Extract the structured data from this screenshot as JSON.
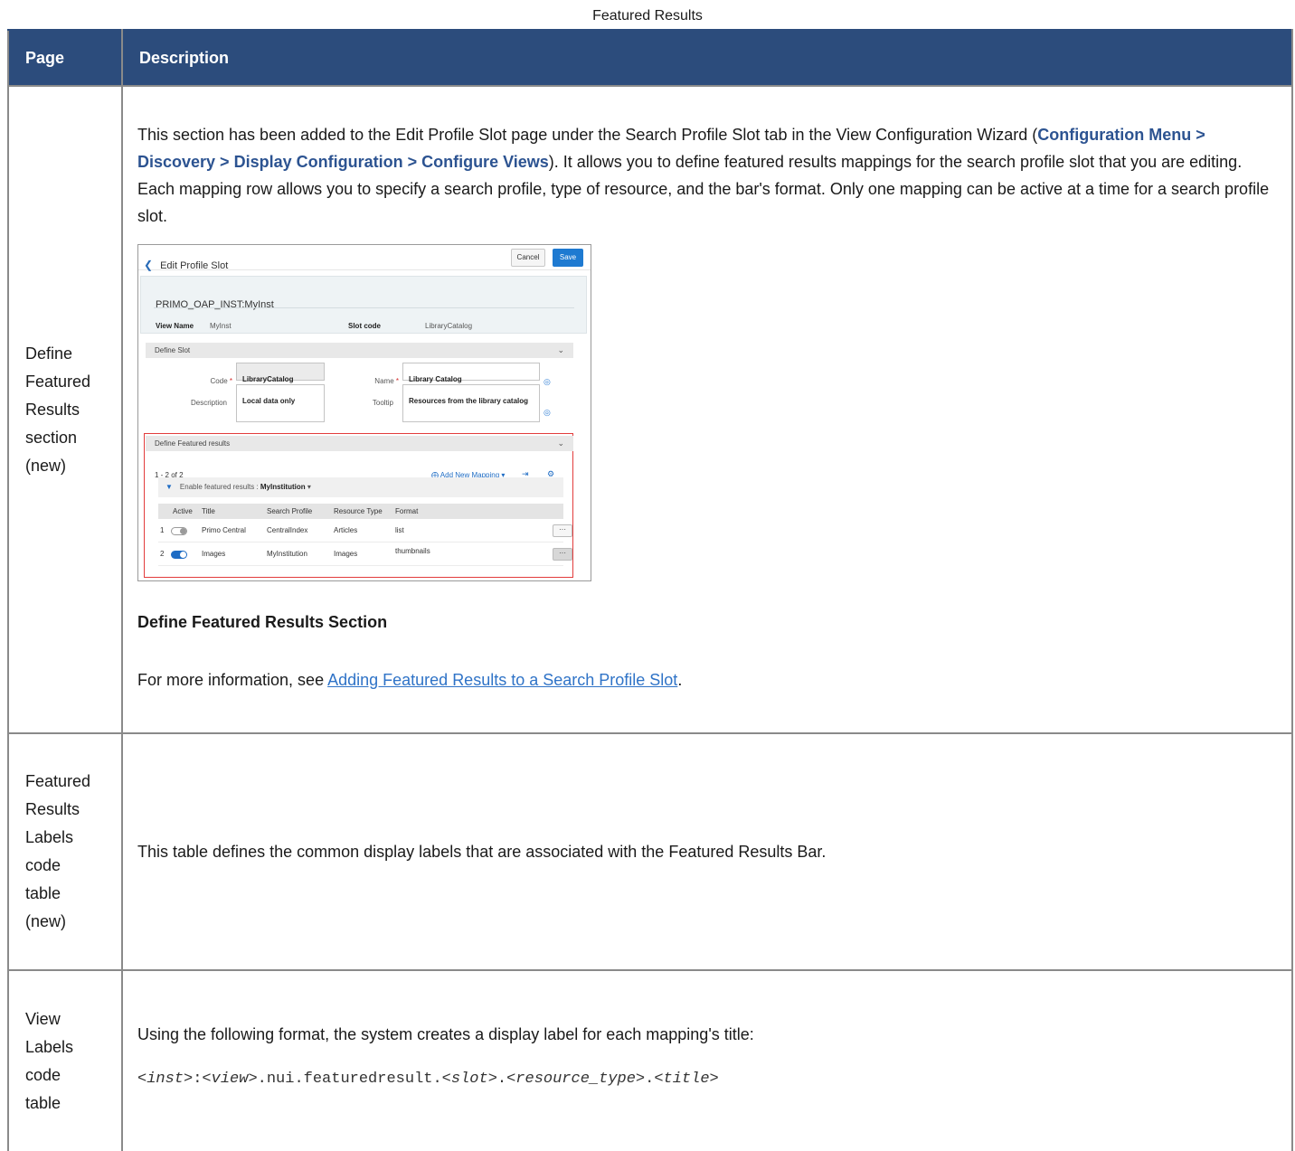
{
  "caption": "Featured Results",
  "header": {
    "col_page": "Page",
    "col_description": "Description"
  },
  "rows": [
    {
      "page": [
        "Define",
        "Featured",
        "Results",
        "section",
        "(new)"
      ],
      "intro_1": "This section has been added to the Edit Profile Slot page under the Search Profile Slot tab in the View Configuration Wizard (",
      "menu_path": "Configuration Menu > Discovery > Display Configuration > Configure Views",
      "intro_2": "). It allows you to define featured results mappings for the search profile slot that you are editing. Each mapping row allows you to specify a search profile, type of resource, and the bar's format. Only one mapping can be active at a time for a search profile slot.",
      "figure_caption": "Define Featured Results Section",
      "more_info_prefix": "For more information, see ",
      "more_info_link": "Adding Featured Results to a Search Profile Slot",
      "more_info_suffix": "."
    },
    {
      "page": [
        "Featured",
        "Results",
        "Labels",
        "code",
        "table",
        "(new)"
      ],
      "text": "This table defines the common display labels that are associated with the Featured Results Bar."
    },
    {
      "page": [
        "View",
        "Labels",
        "code",
        "table"
      ],
      "text": "Using the following format, the system creates a display label for each mapping's title:",
      "code_parts": [
        "<",
        "inst",
        ">:<",
        "view",
        ">.nui.featuredresult.<",
        "slot",
        ">.<",
        "resource_type",
        ">.<",
        "title",
        ">"
      ]
    }
  ],
  "screenshot": {
    "title": "Edit Profile Slot",
    "cancel": "Cancel",
    "save": "Save",
    "inst": "PRIMO_OAP_INST:MyInst",
    "view_name_label": "View Name",
    "view_name_value": "MyInst",
    "slot_code_label": "Slot code",
    "slot_code_value": "LibraryCatalog",
    "define_slot": "Define Slot",
    "code_label": "Code",
    "code_value": "LibraryCatalog",
    "name_label": "Name",
    "name_value": "Library Catalog",
    "description_label": "Description",
    "description_value": "Local data only",
    "tooltip_label": "Tooltip",
    "tooltip_value": "Resources from the library catalog",
    "define_featured": "Define Featured results",
    "count": "1 - 2 of 2",
    "add_mapping": "Add New Mapping",
    "enable_label": "Enable featured results :",
    "enable_value": "MyInstitution",
    "columns": [
      "Active",
      "Title",
      "Search Profile",
      "Resource Type",
      "Format"
    ],
    "mappings": [
      {
        "num": "1",
        "active": false,
        "title": "Primo Central",
        "profile": "CentralIndex",
        "type": "Articles",
        "format": "list"
      },
      {
        "num": "2",
        "active": true,
        "title": "Images",
        "profile": "MyInstitution",
        "type": "Images",
        "format": "thumbnails"
      }
    ],
    "more": "···"
  }
}
